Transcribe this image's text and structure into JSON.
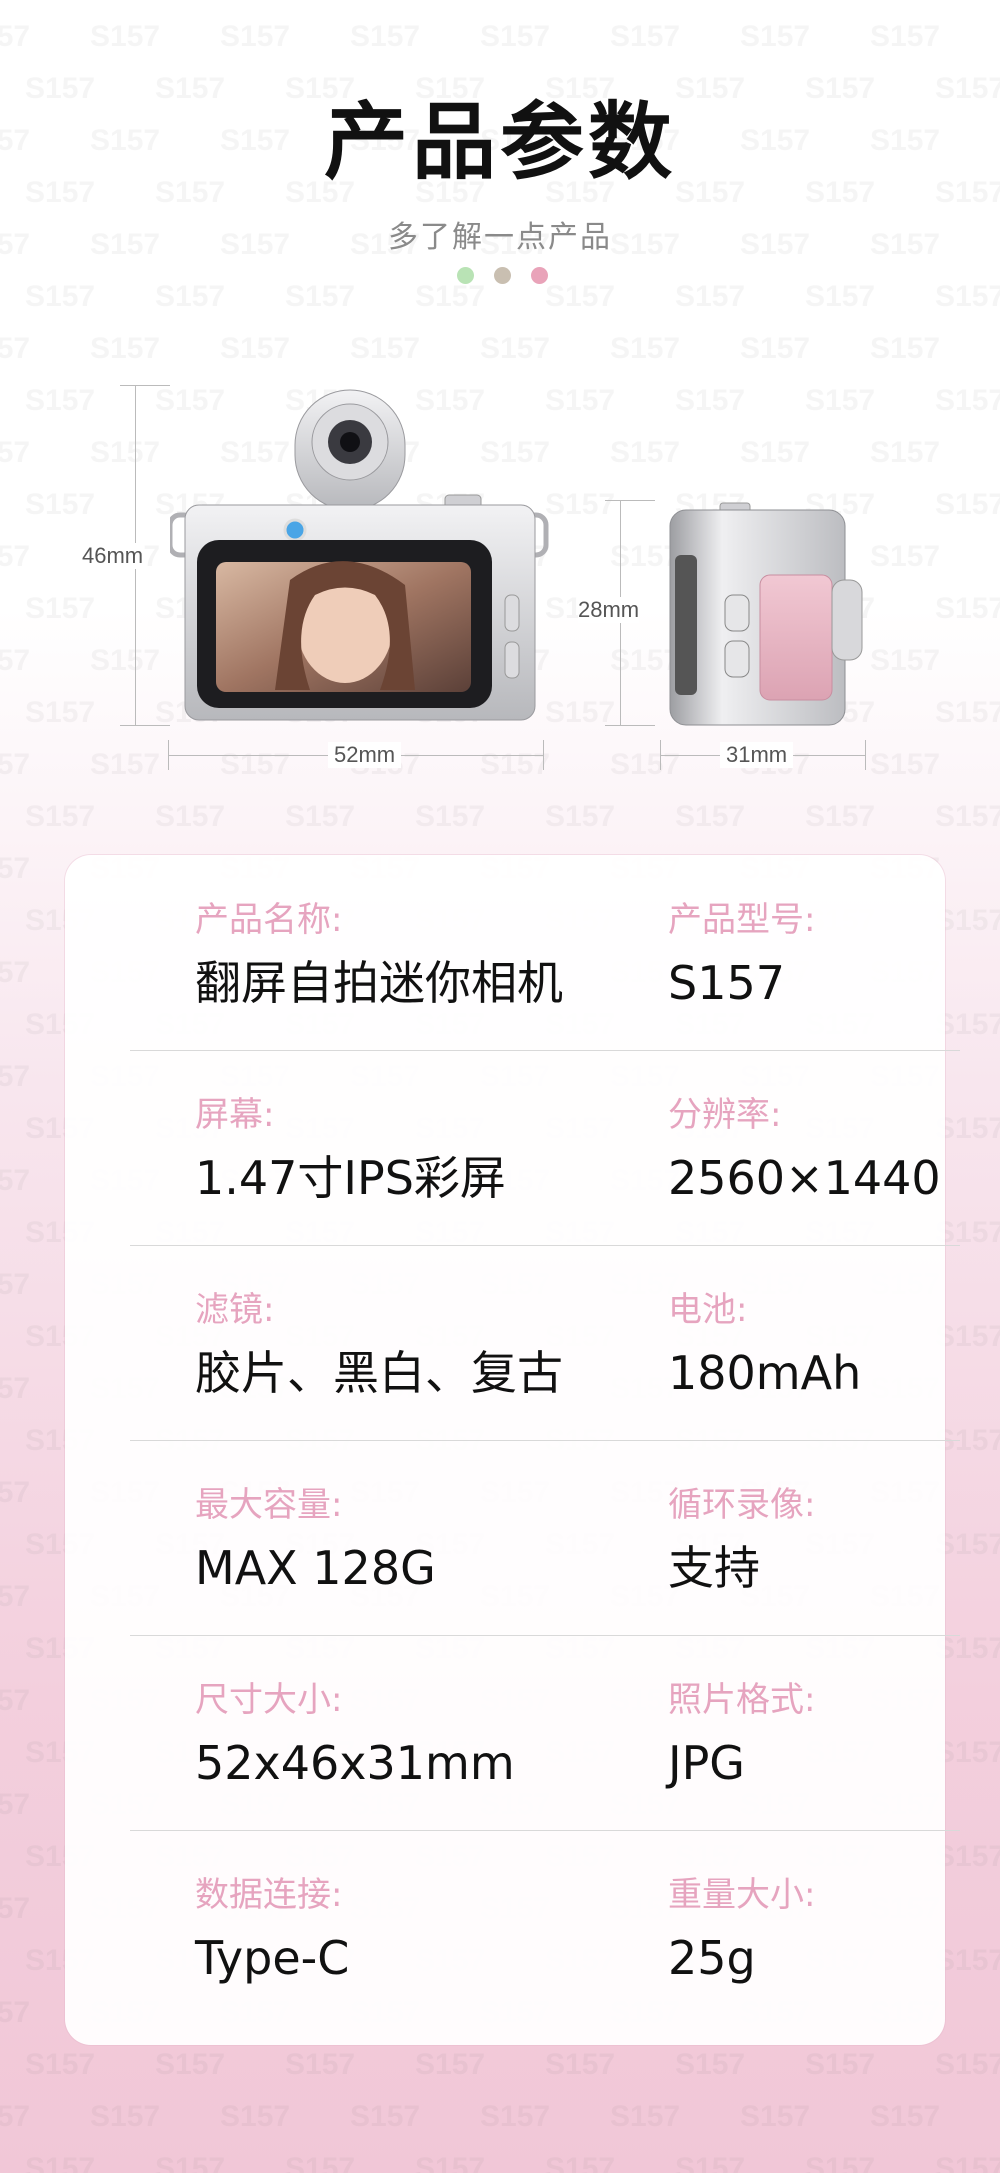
{
  "header": {
    "title": "产品参数",
    "subtitle": "多了解一点产品"
  },
  "dots": [
    "#b9e3b5",
    "#c9bfb1",
    "#e9a3b9"
  ],
  "watermark": "S157",
  "dimensions": {
    "front_height": "46mm",
    "front_width": "52mm",
    "side_height": "28mm",
    "side_width": "31mm"
  },
  "specs": [
    {
      "left_label": "产品名称:",
      "left_value": "翻屏自拍迷你相机",
      "right_label": "产品型号:",
      "right_value": "S157"
    },
    {
      "left_label": "屏幕:",
      "left_value": "1.47寸IPS彩屏",
      "right_label": "分辨率:",
      "right_value": "2560×1440"
    },
    {
      "left_label": "滤镜:",
      "left_value": "胶片、黑白、复古",
      "right_label": "电池:",
      "right_value": "180mAh"
    },
    {
      "left_label": "最大容量:",
      "left_value": "MAX 128G",
      "right_label": "循环录像:",
      "right_value": "支持"
    },
    {
      "left_label": "尺寸大小:",
      "left_value": "52x46x31mm",
      "right_label": "照片格式:",
      "right_value": "JPG"
    },
    {
      "left_label": "数据连接:",
      "left_value": "Type-C",
      "right_label": "重量大小:",
      "right_value": "25g"
    }
  ],
  "colors": {
    "label_pink": "#e6a4bf",
    "camera_pink": "#e9b6c4",
    "camera_silver": "#c9c9cc"
  }
}
